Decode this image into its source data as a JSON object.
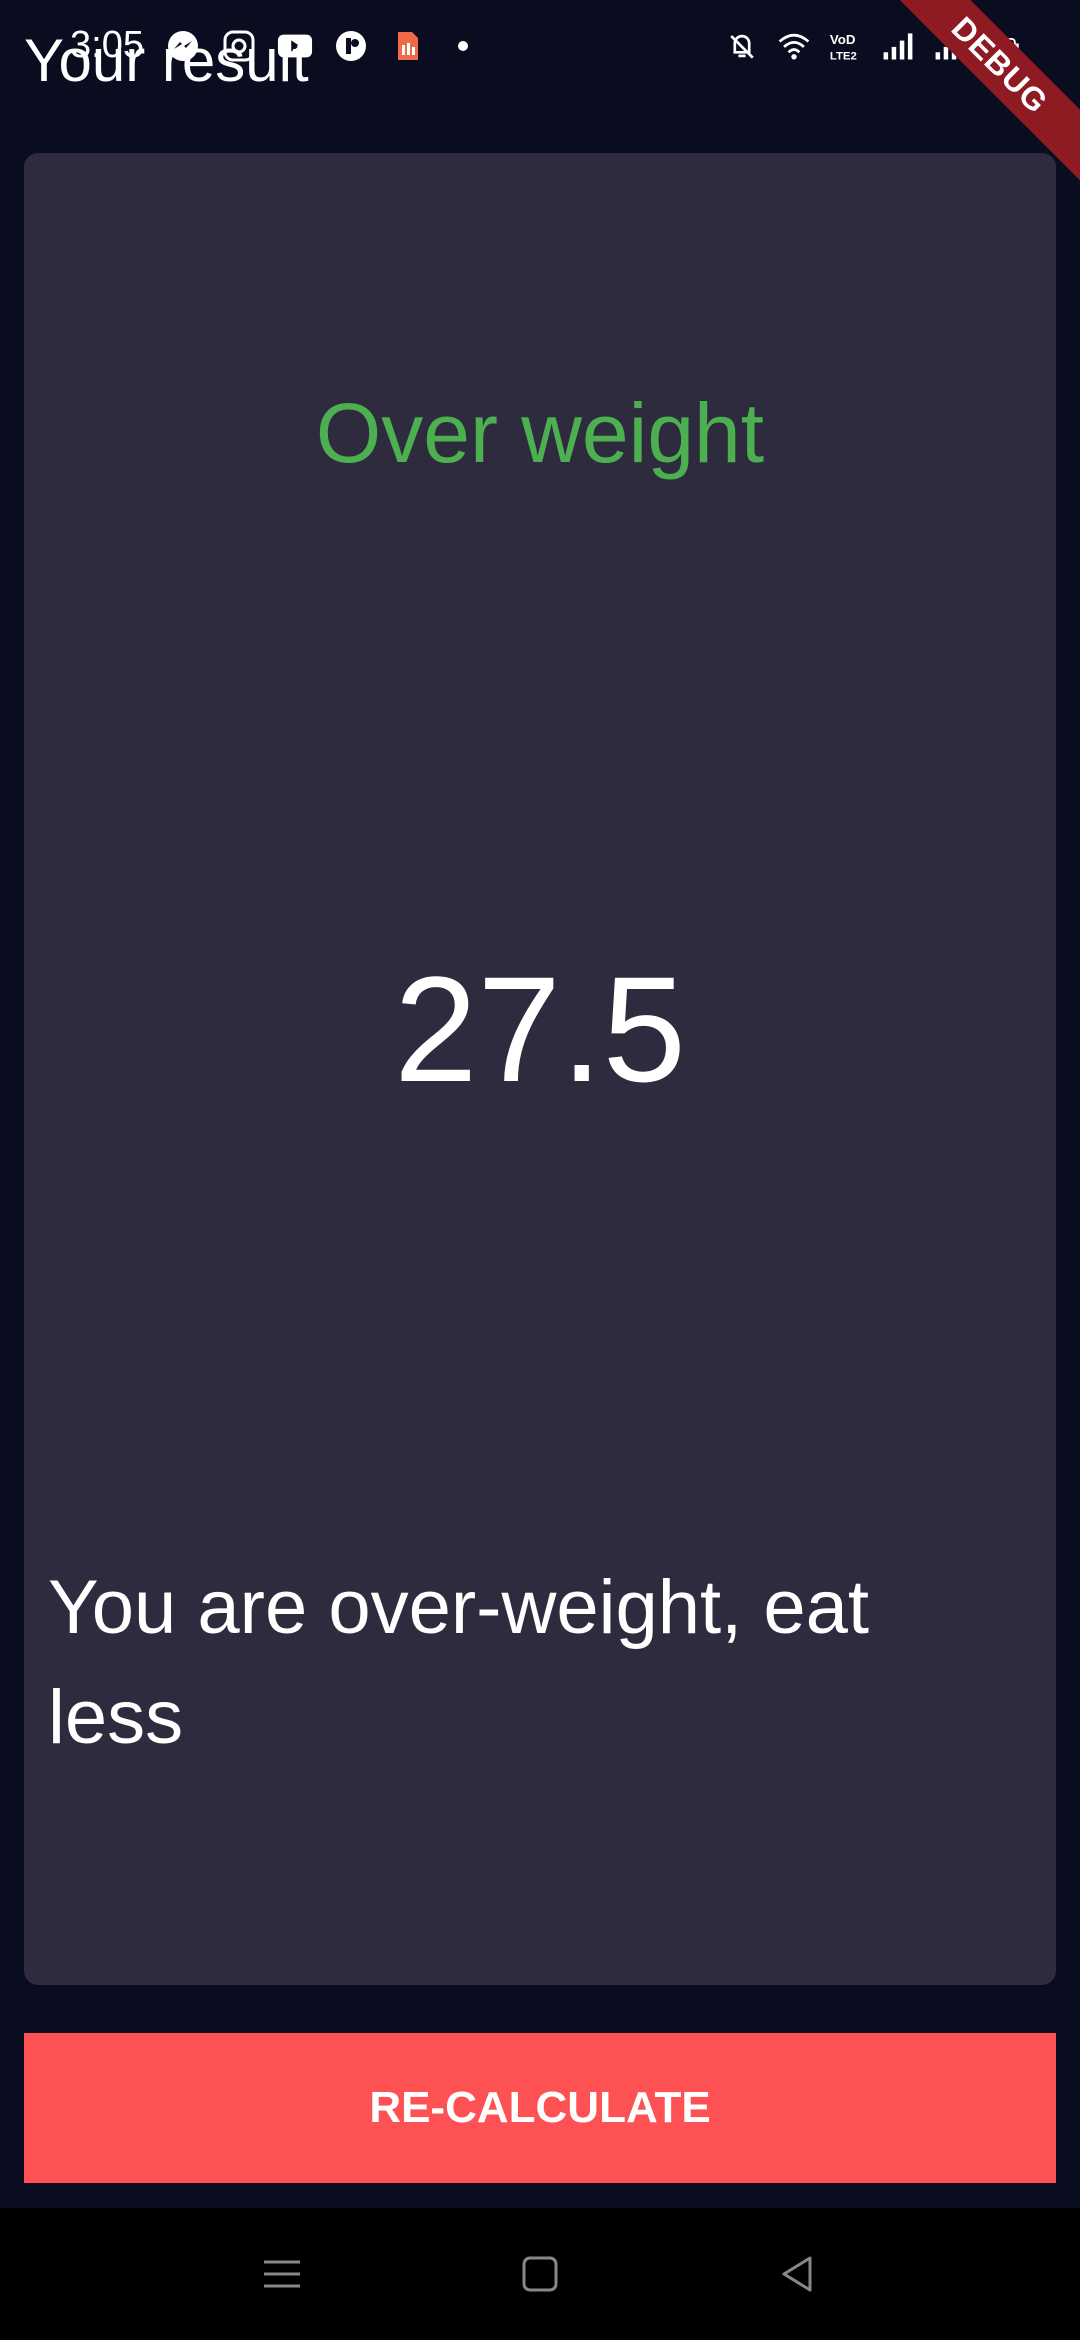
{
  "status_bar": {
    "time": "3:05",
    "left_icons": [
      "messenger-icon",
      "instagram-icon",
      "youtube-icon",
      "app-icon",
      "sim-icon",
      "dot-icon"
    ],
    "right_icons": [
      "mute-icon",
      "wifi-icon",
      "volte-icon",
      "signal-icon",
      "signal-icon",
      "battery-icon"
    ]
  },
  "debug_banner": "DEBUG",
  "app_bar": {
    "title": "Your result"
  },
  "result": {
    "status": "Over weight",
    "bmi": "27.5",
    "advice": "You are over-weight, eat less"
  },
  "button": {
    "recalculate_label": "RE-CALCULATE"
  },
  "nav_bar": {
    "icons": [
      "menu-icon",
      "home-icon",
      "back-icon"
    ]
  },
  "colors": {
    "background": "#0a0d1f",
    "card": "#2f2b3e",
    "status_green": "#4caf50",
    "button_red": "#fe5153",
    "debug_red": "#8e1a22"
  }
}
